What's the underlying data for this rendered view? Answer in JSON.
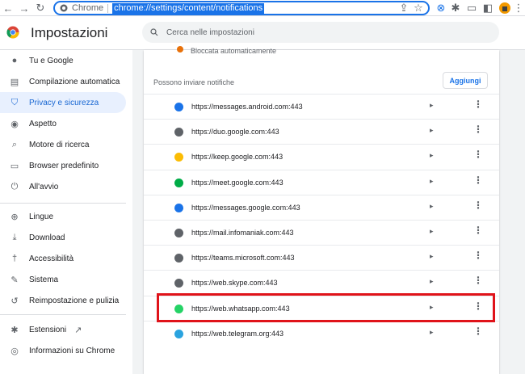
{
  "browser": {
    "omnibox_label": "Chrome",
    "url": "chrome://settings/content/notifications"
  },
  "header": {
    "title": "Impostazioni",
    "search_placeholder": "Cerca nelle impostazioni"
  },
  "sidebar": {
    "items": [
      {
        "label": "Tu e Google",
        "icon": "person-icon"
      },
      {
        "label": "Compilazione automatica",
        "icon": "clipboard-icon"
      },
      {
        "label": "Privacy e sicurezza",
        "icon": "shield-icon",
        "active": true
      },
      {
        "label": "Aspetto",
        "icon": "palette-icon"
      },
      {
        "label": "Motore di ricerca",
        "icon": "search-icon"
      },
      {
        "label": "Browser predefinito",
        "icon": "browser-icon"
      },
      {
        "label": "All'avvio",
        "icon": "power-icon"
      },
      {
        "label": "Lingue",
        "icon": "globe-icon"
      },
      {
        "label": "Download",
        "icon": "download-icon"
      },
      {
        "label": "Accessibilità",
        "icon": "accessibility-icon"
      },
      {
        "label": "Sistema",
        "icon": "wrench-icon"
      },
      {
        "label": "Reimpostazione e pulizia",
        "icon": "restore-icon"
      },
      {
        "label": "Estensioni",
        "icon": "puzzle-icon"
      },
      {
        "label": "Informazioni su Chrome",
        "icon": "chrome-icon"
      }
    ]
  },
  "content": {
    "blocked_text": "Bloccata automaticamente",
    "section_title": "Possono inviare notifiche",
    "add_label": "Aggiungi",
    "sites": [
      {
        "url": "https://messages.android.com:443",
        "icon_color": "#1a73e8"
      },
      {
        "url": "https://duo.google.com:443",
        "icon_color": "#5f6368"
      },
      {
        "url": "https://keep.google.com:443",
        "icon_color": "#fbbc04"
      },
      {
        "url": "https://meet.google.com:443",
        "icon_color": "#00ac47"
      },
      {
        "url": "https://messages.google.com:443",
        "icon_color": "#1a73e8"
      },
      {
        "url": "https://mail.infomaniak.com:443",
        "icon_color": "#5f6368"
      },
      {
        "url": "https://teams.microsoft.com:443",
        "icon_color": "#5f6368"
      },
      {
        "url": "https://web.skype.com:443",
        "icon_color": "#5f6368"
      },
      {
        "url": "https://web.whatsapp.com:443",
        "icon_color": "#25d366",
        "highlighted": true
      },
      {
        "url": "https://web.telegram.org:443",
        "icon_color": "#2aa3df"
      }
    ]
  },
  "colors": {
    "accent": "#1a73e8",
    "highlight": "#e0131a"
  }
}
